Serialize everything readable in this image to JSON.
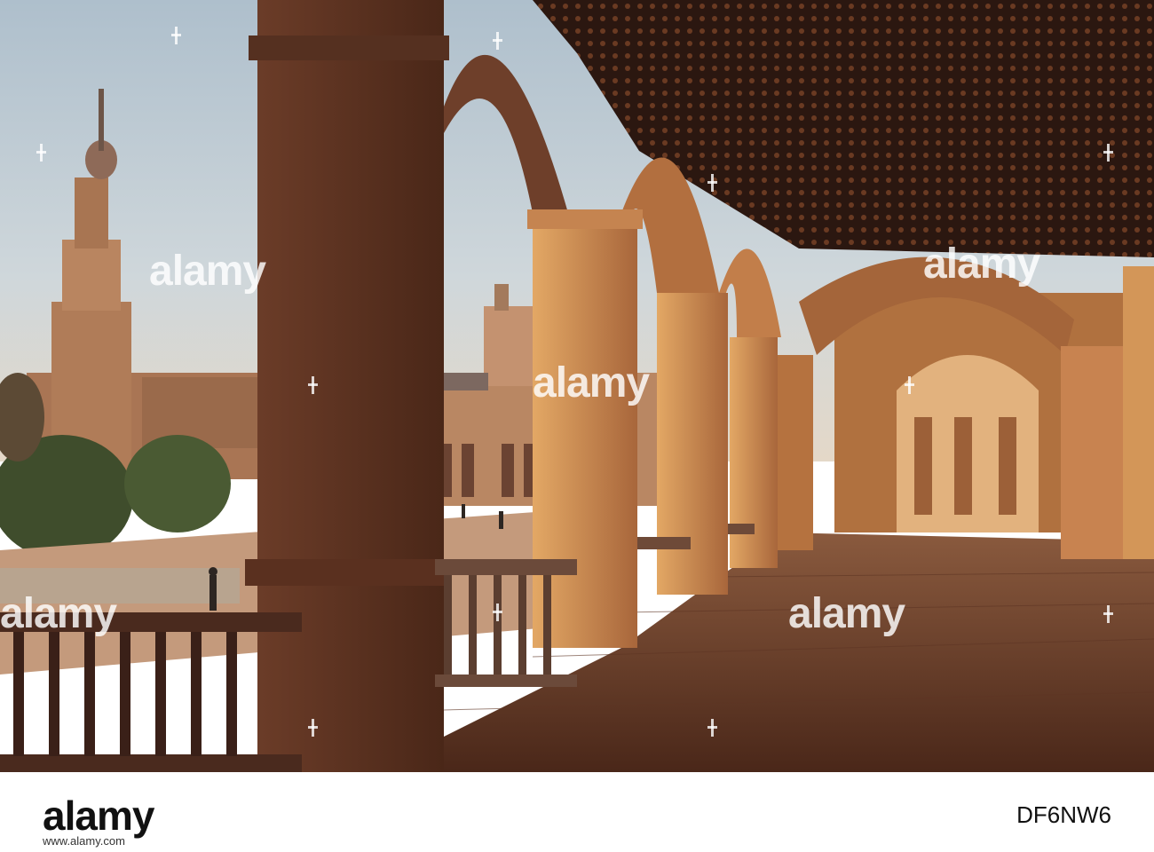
{
  "watermark": {
    "word": "alamy"
  },
  "footer": {
    "brand": "alamy",
    "image_id": "DF6NW6",
    "url": "www.alamy.com"
  },
  "colors": {
    "sky": "#c9d6df",
    "brick_lit": "#d79a58",
    "brick_shadow": "#5b3426",
    "ceiling": "#2a1610",
    "floor": "#6e3f2d"
  }
}
